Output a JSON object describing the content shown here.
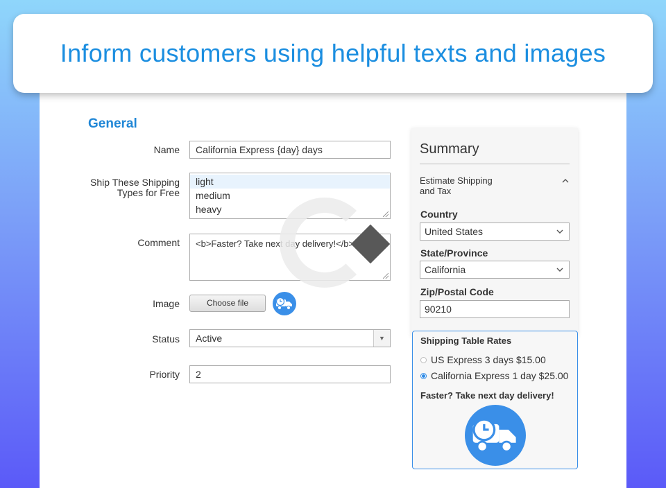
{
  "headline": "Inform customers using helpful texts and images",
  "form": {
    "section_title": "General",
    "name": {
      "label": "Name",
      "value": "California Express {day} days"
    },
    "free_types": {
      "label": "Ship These Shipping Types for Free",
      "options": [
        "light",
        "medium",
        "heavy"
      ],
      "selected": "light"
    },
    "comment": {
      "label": "Comment",
      "value": "<b>Faster? Take next day delivery!</b>"
    },
    "image": {
      "label": "Image",
      "button": "Choose file",
      "thumbnail_icon": "delivery-truck-icon"
    },
    "status": {
      "label": "Status",
      "value": "Active"
    },
    "priority": {
      "label": "Priority",
      "value": "2"
    }
  },
  "summary": {
    "title": "Summary",
    "estimate_label": "Estimate Shipping and Tax",
    "country": {
      "label": "Country",
      "value": "United States"
    },
    "state": {
      "label": "State/Province",
      "value": "California"
    },
    "zip": {
      "label": "Zip/Postal Code",
      "value": "90210"
    },
    "rates": {
      "title": "Shipping Table Rates",
      "options": [
        {
          "label": "US Express 3 days $15.00",
          "selected": false
        },
        {
          "label": "California Express 1 day $25.00",
          "selected": true
        }
      ],
      "promo_text": "Faster? Take next day delivery!",
      "promo_icon": "delivery-truck-icon"
    }
  },
  "colors": {
    "accent": "#1b8ee0",
    "icon_bg": "#3a8fe8"
  }
}
